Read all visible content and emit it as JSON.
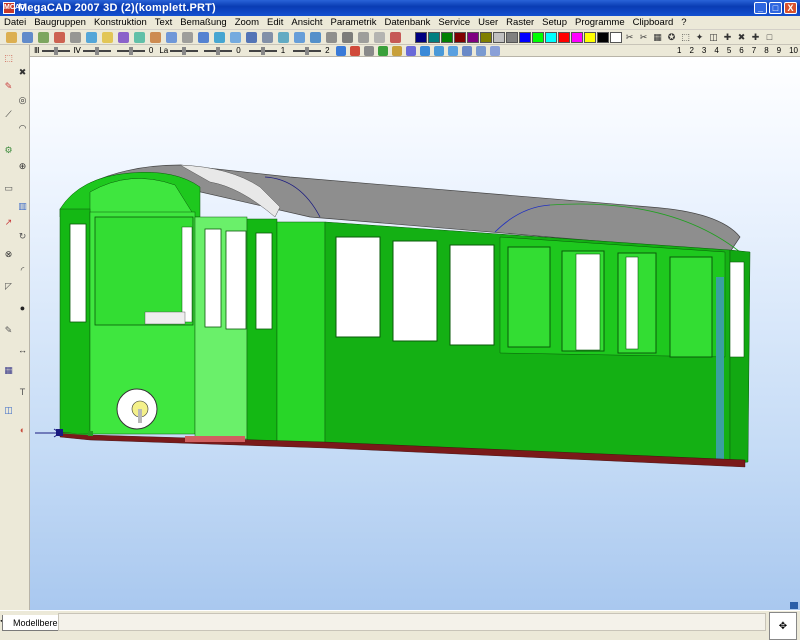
{
  "window": {
    "app_badge": "MCAD",
    "title": "MegaCAD 2007 3D (2)(komplett.PRT)",
    "minimize": "_",
    "maximize": "□",
    "close": "X"
  },
  "menu": [
    "Datei",
    "Baugruppen",
    "Konstruktion",
    "Text",
    "Bemaßung",
    "Zoom",
    "Edit",
    "Ansicht",
    "Parametrik",
    "Datenbank",
    "Service",
    "User",
    "Raster",
    "Setup",
    "Programme",
    "Clipboard",
    "?"
  ],
  "toolbar2": {
    "items": [
      {
        "label": "Ⅲ",
        "num": ""
      },
      {
        "label": "Ⅳ",
        "num": ""
      },
      {
        "label": "",
        "num": "0"
      },
      {
        "label": "La",
        "num": ""
      },
      {
        "label": "",
        "num": "0"
      },
      {
        "label": "",
        "num": "1"
      },
      {
        "label": "",
        "num": "2"
      }
    ],
    "icons": [
      "layer-icon",
      "pen-icon",
      "group-icon",
      "color-icon",
      "style-icon",
      "rotate-icon",
      "cube-icon",
      "sphere-icon",
      "cylinder-icon",
      "cone-icon",
      "torus-icon",
      "box-icon"
    ],
    "num_buttons": [
      "1",
      "2",
      "3",
      "4",
      "5",
      "6",
      "7",
      "8",
      "9",
      "10"
    ]
  },
  "palette": [
    "#000080",
    "#008080",
    "#008000",
    "#800000",
    "#800080",
    "#808000",
    "#c0c0c0",
    "#808080",
    "#0000ff",
    "#00ff00",
    "#00ffff",
    "#ff0000",
    "#ff00ff",
    "#ffff00",
    "#000000",
    "#ffffff"
  ],
  "leftbar_icons": [
    "select-icon",
    "delete-icon",
    "pencil-icon",
    "circle-icon",
    "line-icon",
    "arc-icon",
    "gear-icon",
    "measure-icon",
    "box-icon",
    "cylinder-icon",
    "extrude-icon",
    "revolve-icon",
    "boolean-icon",
    "fillet-icon",
    "chamfer-icon",
    "sphere-icon",
    "edit-icon",
    "dimension-icon",
    "hatch-icon",
    "text-icon",
    "view-icon",
    "shade-icon"
  ],
  "status": {
    "tab_label": "Modellbereich"
  },
  "colors": {
    "car_body": "#1ec81e",
    "car_body_dark": "#0fa00f",
    "car_front": "#3fe63f",
    "roof": "#909090",
    "window_glass": "#ffffff",
    "base": "#7a1a1a"
  }
}
